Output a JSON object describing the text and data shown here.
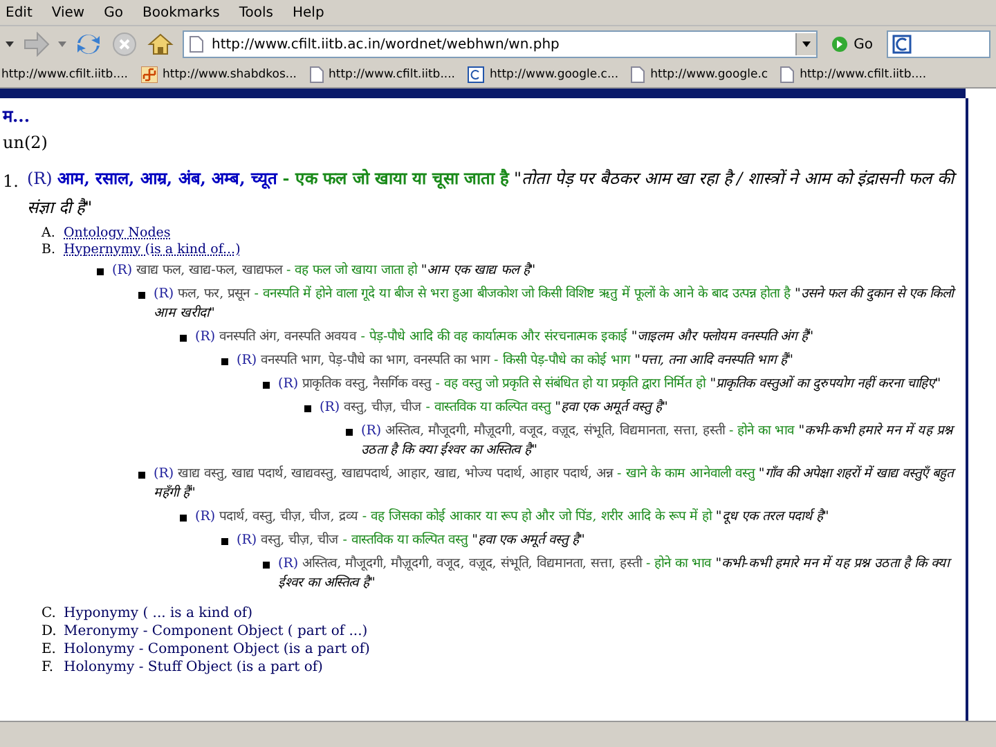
{
  "menu": [
    "Edit",
    "View",
    "Go",
    "Bookmarks",
    "Tools",
    "Help"
  ],
  "toolbar": {
    "url": "http://www.cfilt.iitb.ac.in/wordnet/webhwn/wn.php",
    "go": "Go"
  },
  "bookmarks": [
    {
      "kind": "none",
      "label": "http://www.cfilt.iitb...."
    },
    {
      "kind": "mark",
      "label": "http://www.shabdkos..."
    },
    {
      "kind": "page",
      "label": "http://www.cfilt.iitb...."
    },
    {
      "kind": "frame",
      "label": "http://www.google.c..."
    },
    {
      "kind": "page",
      "label": "http://www.google.c"
    },
    {
      "kind": "page",
      "label": "http://www.cfilt.iitb...."
    }
  ],
  "page": {
    "heading": "म...",
    "pos": "un(2)",
    "sense": {
      "number": "1.",
      "tag": "(R)",
      "synonyms": "आम, रसाल, आम्र, अंब, अम्ब, च्यूत",
      "gloss": "- एक फल जो खाया या चूसा जाता है",
      "example": "\"तोता पेड़ पर बैठकर आम खा रहा है / शास्त्रों ने आम को इंद्रासनी फल की संज्ञा दी है\""
    },
    "relations_top": [
      {
        "letter": "A.",
        "label": "Ontology Nodes"
      },
      {
        "letter": "B.",
        "label": "Hypernymy (is a kind of...)"
      }
    ],
    "tree": [
      {
        "tag": "(R)",
        "synonyms": "खाद्य फल, खाद्य-फल, खाद्यफल",
        "gloss": "- वह फल जो खाया जाता हो",
        "example": "\"आम एक खाद्य फल है\"",
        "children": [
          {
            "tag": "(R)",
            "synonyms": "फल, फर, प्रसून",
            "gloss": "- वनस्पति में होने वाला गूदे या बीज से भरा हुआ बीजकोश जो किसी विशिष्ट ऋतु में फूलों के आने के बाद उत्पन्न होता है",
            "example": "\"उसने फल की दुकान से एक किलो आम खरीदा\"",
            "children": [
              {
                "tag": "(R)",
                "synonyms": "वनस्पति अंग, वनस्पति अवयव",
                "gloss": "- पेड़-पौधे आदि की वह कार्यात्मक और संरचनात्मक इकाई",
                "example": "\"जाइलम और फ्लोयम वनस्पति अंग हैं\"",
                "children": [
                  {
                    "tag": "(R)",
                    "synonyms": "वनस्पति भाग, पेड़-पौधे का भाग, वनस्पति का भाग",
                    "gloss": "- किसी पेड़-पौधे का कोई भाग",
                    "example": "\"पत्ता, तना आदि वनस्पति भाग हैं\"",
                    "children": [
                      {
                        "tag": "(R)",
                        "synonyms": "प्राकृतिक वस्तु, नैसर्गिक वस्तु",
                        "gloss": "- वह वस्तु जो प्रकृति से संबंधित हो या प्रकृति द्वारा निर्मित हो",
                        "example": "\"प्राकृतिक वस्तुओं का दुरुपयोग नहीं करना चाहिए\"",
                        "children": [
                          {
                            "tag": "(R)",
                            "synonyms": "वस्तु, चीज़, चीज",
                            "gloss": "- वास्तविक या कल्पित वस्तु",
                            "example": "\"हवा एक अमूर्त वस्तु है\"",
                            "children": [
                              {
                                "tag": "(R)",
                                "synonyms": "अस्तित्व, मौजूदगी, मौज़ूदगी, वजूद, वज़ूद, संभूति, विद्यमानता, सत्ता, हस्ती",
                                "gloss": "- होने का भाव",
                                "example": "\"कभी-कभी हमारे मन में यह प्रश्न उठता है कि क्या ईश्वर का अस्तित्व है\""
                              }
                            ]
                          }
                        ]
                      }
                    ]
                  }
                ]
              }
            ]
          },
          {
            "tag": "(R)",
            "synonyms": "खाद्य वस्तु, खाद्य पदार्थ, खाद्यवस्तु, खाद्यपदार्थ, आहार, खाद्य, भोज्य पदार्थ, आहार पदार्थ, अन्न",
            "gloss": "- खाने के काम आनेवाली वस्तु",
            "example": "\"गाँव की अपेक्षा शहरों में खाद्य वस्तुएँ बहुत महँगी हैं\"",
            "children": [
              {
                "tag": "(R)",
                "synonyms": "पदार्थ, वस्तु, चीज़, चीज, द्रव्य",
                "gloss": "- वह जिसका कोई आकार या रूप हो और जो पिंड, शरीर आदि के रूप में हो",
                "example": "\"दूध एक तरल पदार्थ है\"",
                "children": [
                  {
                    "tag": "(R)",
                    "synonyms": "वस्तु, चीज़, चीज",
                    "gloss": "- वास्तविक या कल्पित वस्तु",
                    "example": "\"हवा एक अमूर्त वस्तु है\"",
                    "children": [
                      {
                        "tag": "(R)",
                        "synonyms": "अस्तित्व, मौजूदगी, मौज़ूदगी, वजूद, वज़ूद, संभूति, विद्यमानता, सत्ता, हस्ती",
                        "gloss": "- होने का भाव",
                        "example": "\"कभी-कभी हमारे मन में यह प्रश्न उठता है कि क्या ईश्वर का अस्तित्व है\""
                      }
                    ]
                  }
                ]
              }
            ]
          }
        ]
      }
    ],
    "relations_bottom": [
      {
        "letter": "C.",
        "label": "Hyponymy ( ... is a kind of)"
      },
      {
        "letter": "D.",
        "label": "Meronymy - Component Object ( part of ...)"
      },
      {
        "letter": "E.",
        "label": "Holonymy - Component Object (is a part of)"
      },
      {
        "letter": "F.",
        "label": "Holonymy - Stuff Object (is a part of)"
      }
    ]
  }
}
